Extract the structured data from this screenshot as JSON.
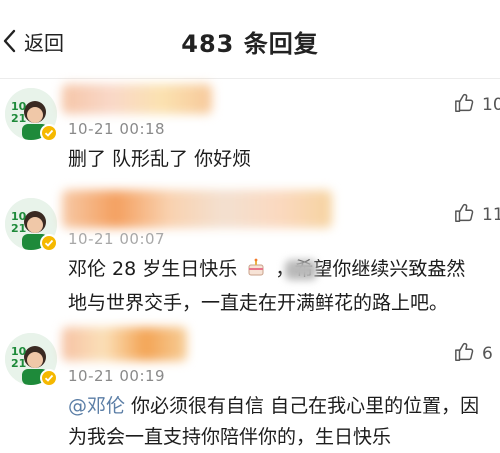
{
  "header": {
    "back_label": "返回",
    "title": "483 条回复"
  },
  "comments": [
    {
      "time": "10-21 00:18",
      "text": "删了 队形乱了 你好烦",
      "likes": "10"
    },
    {
      "time": "10-21 00:07",
      "text_a": "邓伦 28 岁生日快乐",
      "text_b": "，希望你继续兴致盎然地与世界交手，一直走在开满鲜花的路上吧。",
      "likes": "11"
    },
    {
      "time": "10-21 00:19",
      "mention": "@邓伦",
      "text": " 你必须很有自信 自己在我心里的位置，因为我会一直支持你陪伴你的，生日快乐",
      "likes": "6"
    }
  ],
  "icons": {
    "back": "chevron-left-icon",
    "like": "thumbs-up-icon",
    "avatar": "avatar",
    "verified": "verified-badge-icon",
    "cake": "cake-emoji-icon"
  },
  "colors": {
    "mention": "#5b7ea6",
    "timestamp": "#8a8a8a",
    "avatar_bg": "#e8f3ea",
    "avatar_brand": "#1e8a3a",
    "verified": "#f5b800"
  }
}
